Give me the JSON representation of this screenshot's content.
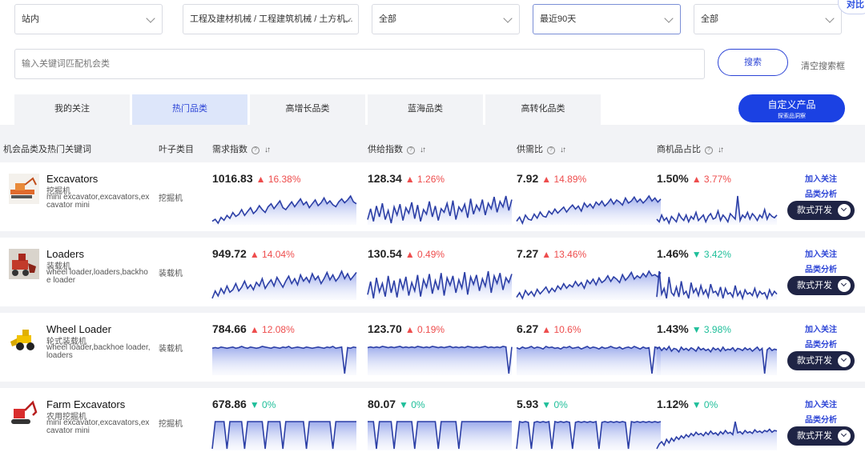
{
  "filters": {
    "site": "站内",
    "category": "工程及建材机械 / 工程建筑机械 / 土方机...",
    "region": "全部",
    "period": "最近90天",
    "other": "全部"
  },
  "compare_badge": "对比",
  "search": {
    "placeholder": "输入关键词匹配机会类",
    "button": "搜索",
    "clear": "清空搜索框"
  },
  "tabs": [
    "我的关注",
    "热门品类",
    "高增长品类",
    "蓝海品类",
    "高转化品类"
  ],
  "custom_product": {
    "title": "自定义产品",
    "subtitle": "探索品洞察"
  },
  "columns": {
    "product": "机会品类及热门关键词",
    "leaf": "叶子类目",
    "demand": "需求指数",
    "supply": "供给指数",
    "ratio": "供需比",
    "share": "商机品占比"
  },
  "actions": {
    "follow": "加入关注",
    "analyze": "品类分析",
    "develop": "款式开发"
  },
  "colors": {
    "up": "#ee4d4d",
    "down": "#1fbf9a",
    "accent": "#1b41e3",
    "line": "#2c3fa6"
  },
  "rows": [
    {
      "name": "Excavators",
      "name_cn": "挖掘机",
      "keywords": "mini excavator,excavators,excavator mini",
      "leaf": "挖掘机",
      "thumb_icon": "excavator-photo-icon",
      "metrics": {
        "demand": {
          "value": "1016.83",
          "change": "16.38%",
          "dir": "up",
          "series": [
            24,
            26,
            22,
            28,
            25,
            30,
            27,
            33,
            29,
            31,
            36,
            30,
            34,
            38,
            32,
            35,
            40,
            36,
            33,
            39,
            42,
            37,
            41,
            45,
            38,
            36,
            40,
            44,
            39,
            43,
            47,
            41,
            44,
            38,
            42,
            46,
            40,
            43,
            48,
            42,
            45,
            41,
            39,
            44,
            47,
            43,
            46,
            50,
            44,
            42
          ]
        },
        "supply": {
          "value": "128.34",
          "change": "1.26%",
          "dir": "up",
          "series": [
            30,
            42,
            28,
            45,
            33,
            48,
            30,
            40,
            26,
            44,
            35,
            47,
            29,
            43,
            37,
            49,
            31,
            46,
            28,
            41,
            36,
            50,
            33,
            45,
            29,
            42,
            38,
            48,
            34,
            51,
            30,
            44,
            39,
            47,
            32,
            53,
            36,
            46,
            40,
            52,
            35,
            48,
            42,
            55,
            38,
            50,
            44,
            56,
            40,
            52
          ]
        },
        "ratio": {
          "value": "7.92",
          "change": "14.89%",
          "dir": "up",
          "series": [
            26,
            30,
            24,
            32,
            28,
            27,
            33,
            29,
            35,
            31,
            30,
            36,
            33,
            38,
            34,
            37,
            40,
            35,
            39,
            42,
            38,
            41,
            36,
            44,
            40,
            43,
            39,
            45,
            42,
            46,
            41,
            44,
            48,
            43,
            47,
            45,
            42,
            49,
            44,
            46,
            50,
            45,
            48,
            44,
            47,
            51,
            46,
            49,
            45,
            48
          ]
        },
        "share": {
          "value": "1.50%",
          "change": "3.77%",
          "dir": "up",
          "series": [
            32,
            30,
            35,
            31,
            33,
            29,
            34,
            32,
            30,
            36,
            33,
            31,
            35,
            30,
            34,
            32,
            37,
            31,
            33,
            35,
            30,
            34,
            36,
            32,
            33,
            38,
            31,
            35,
            33,
            30,
            36,
            34,
            32,
            49,
            31,
            35,
            33,
            37,
            32,
            36,
            34,
            31,
            35,
            33,
            39,
            32,
            36,
            34,
            33,
            35
          ]
        }
      }
    },
    {
      "name": "Loaders",
      "name_cn": "装载机",
      "keywords": "wheel loader,loaders,backhoe loader",
      "leaf": "装载机",
      "thumb_icon": "loader-photo-icon",
      "metrics": {
        "demand": {
          "value": "949.72",
          "change": "14.04%",
          "dir": "up",
          "series": [
            28,
            34,
            30,
            36,
            32,
            38,
            33,
            35,
            40,
            34,
            37,
            42,
            36,
            39,
            35,
            41,
            38,
            44,
            36,
            40,
            43,
            38,
            45,
            41,
            37,
            42,
            46,
            40,
            44,
            39,
            47,
            42,
            45,
            41,
            48,
            43,
            46,
            40,
            44,
            49,
            43,
            47,
            42,
            45,
            50,
            44,
            48,
            43,
            46,
            49
          ]
        },
        "supply": {
          "value": "130.54",
          "change": "0.49%",
          "dir": "up",
          "series": [
            32,
            46,
            28,
            50,
            35,
            44,
            30,
            52,
            34,
            47,
            29,
            49,
            38,
            51,
            31,
            45,
            36,
            53,
            30,
            48,
            40,
            54,
            33,
            47,
            37,
            55,
            31,
            50,
            42,
            52,
            34,
            48,
            39,
            56,
            32,
            51,
            43,
            53,
            36,
            49,
            41,
            57,
            34,
            52,
            44,
            55,
            37,
            50,
            45,
            54
          ]
        },
        "ratio": {
          "value": "7.27",
          "change": "13.46%",
          "dir": "up",
          "series": [
            28,
            32,
            27,
            34,
            30,
            33,
            29,
            35,
            31,
            34,
            37,
            32,
            36,
            33,
            38,
            35,
            40,
            36,
            39,
            37,
            42,
            38,
            41,
            36,
            43,
            40,
            44,
            39,
            45,
            41,
            43,
            47,
            42,
            46,
            44,
            41,
            48,
            43,
            46,
            50,
            44,
            47,
            45,
            49,
            46,
            51,
            47,
            48,
            46,
            50
          ]
        },
        "share": {
          "value": "1.46%",
          "change": "3.42%",
          "dir": "down",
          "series": [
            34,
            52,
            36,
            40,
            33,
            48,
            37,
            35,
            41,
            34,
            45,
            36,
            38,
            33,
            44,
            37,
            40,
            35,
            42,
            36,
            39,
            34,
            43,
            37,
            38,
            35,
            41,
            33,
            40,
            36,
            37,
            34,
            42,
            35,
            38,
            33,
            39,
            36,
            37,
            35,
            40,
            34,
            38,
            36,
            37,
            33,
            39,
            35,
            38,
            36
          ]
        }
      }
    },
    {
      "name": "Wheel Loader",
      "name_cn": "轮式装载机",
      "keywords": "wheel loader,backhoe loader,loaders",
      "leaf": "装载机",
      "thumb_icon": "wheel-loader-photo-icon",
      "metrics": {
        "demand": {
          "value": "784.66",
          "change": "12.08%",
          "dir": "up",
          "series": [
            52,
            53,
            52,
            54,
            53,
            52,
            53,
            54,
            52,
            53,
            55,
            53,
            52,
            54,
            53,
            52,
            53,
            55,
            54,
            53,
            52,
            54,
            53,
            52,
            54,
            53,
            55,
            52,
            53,
            54,
            53,
            52,
            54,
            53,
            52,
            53,
            54,
            53,
            52,
            54,
            53,
            55,
            52,
            53,
            54,
            10,
            53,
            52,
            54,
            53
          ]
        },
        "supply": {
          "value": "123.70",
          "change": "0.19%",
          "dir": "up",
          "series": [
            54,
            55,
            54,
            55,
            54,
            56,
            55,
            54,
            55,
            54,
            55,
            56,
            54,
            55,
            54,
            55,
            54,
            56,
            55,
            54,
            55,
            54,
            56,
            55,
            54,
            55,
            54,
            55,
            56,
            54,
            55,
            54,
            55,
            54,
            56,
            55,
            54,
            55,
            54,
            55,
            56,
            54,
            55,
            54,
            55,
            54,
            56,
            55,
            10,
            55
          ]
        },
        "ratio": {
          "value": "6.27",
          "change": "10.6%",
          "dir": "up",
          "series": [
            52,
            50,
            53,
            51,
            52,
            54,
            51,
            53,
            52,
            50,
            54,
            52,
            53,
            51,
            52,
            50,
            53,
            52,
            54,
            51,
            52,
            53,
            50,
            52,
            54,
            51,
            53,
            52,
            50,
            53,
            51,
            52,
            54,
            52,
            51,
            53,
            50,
            52,
            53,
            51,
            54,
            52,
            50,
            53,
            51,
            52,
            12,
            53,
            52,
            51
          ]
        },
        "share": {
          "value": "1.43%",
          "change": "3.98%",
          "dir": "down",
          "series": [
            50,
            53,
            48,
            52,
            49,
            54,
            47,
            51,
            50,
            46,
            53,
            49,
            51,
            48,
            52,
            50,
            47,
            53,
            49,
            51,
            48,
            50,
            46,
            52,
            49,
            51,
            47,
            53,
            48,
            50,
            49,
            52,
            47,
            51,
            50,
            48,
            52,
            49,
            51,
            47,
            50,
            53,
            48,
            51,
            14,
            49,
            52,
            48,
            50,
            49
          ]
        }
      }
    },
    {
      "name": "Farm Excavators",
      "name_cn": "农用挖掘机",
      "keywords": "mini excavator,excavators,excavator mini",
      "leaf": "挖掘机",
      "thumb_icon": "farm-excavator-photo-icon",
      "metrics": {
        "demand": {
          "value": "678.86",
          "change": "0%",
          "dir": "down",
          "series": [
            2,
            40,
            40,
            40,
            40,
            2,
            40,
            40,
            40,
            40,
            40,
            2,
            40,
            40,
            40,
            40,
            40,
            40,
            2,
            40,
            40,
            40,
            40,
            40,
            2,
            40,
            40,
            40,
            40,
            40,
            40,
            40,
            2,
            40,
            40,
            40,
            40,
            40,
            40,
            40,
            40,
            2,
            40,
            40,
            40,
            40,
            40,
            40,
            40,
            40
          ]
        },
        "supply": {
          "value": "80.07",
          "change": "0%",
          "dir": "down",
          "series": [
            40,
            40,
            40,
            2,
            40,
            40,
            40,
            40,
            40,
            2,
            40,
            40,
            40,
            40,
            40,
            40,
            2,
            40,
            40,
            40,
            40,
            40,
            40,
            40,
            2,
            40,
            40,
            40,
            40,
            40,
            40,
            2,
            40,
            40,
            40,
            40,
            40,
            40,
            40,
            40,
            40,
            40,
            40,
            40,
            40,
            40,
            40,
            40,
            40,
            40
          ]
        },
        "ratio": {
          "value": "5.93",
          "change": "0%",
          "dir": "down",
          "series": [
            2,
            42,
            41,
            42,
            41,
            2,
            41,
            42,
            41,
            42,
            41,
            42,
            2,
            42,
            41,
            42,
            41,
            42,
            41,
            2,
            41,
            42,
            41,
            42,
            41,
            42,
            41,
            42,
            2,
            41,
            42,
            41,
            42,
            41,
            42,
            41,
            42,
            41,
            2,
            42,
            41,
            42,
            41,
            42,
            41,
            42,
            41,
            42,
            41,
            42
          ]
        },
        "share": {
          "value": "1.12%",
          "change": "0%",
          "dir": "down",
          "series": [
            2,
            10,
            14,
            8,
            18,
            12,
            20,
            15,
            22,
            18,
            24,
            20,
            26,
            22,
            28,
            24,
            30,
            26,
            28,
            24,
            30,
            26,
            32,
            27,
            29,
            25,
            31,
            27,
            33,
            28,
            30,
            26,
            48,
            29,
            31,
            27,
            33,
            29,
            31,
            28,
            34,
            30,
            32,
            29,
            33,
            31,
            35,
            30,
            33,
            32
          ]
        }
      }
    }
  ]
}
